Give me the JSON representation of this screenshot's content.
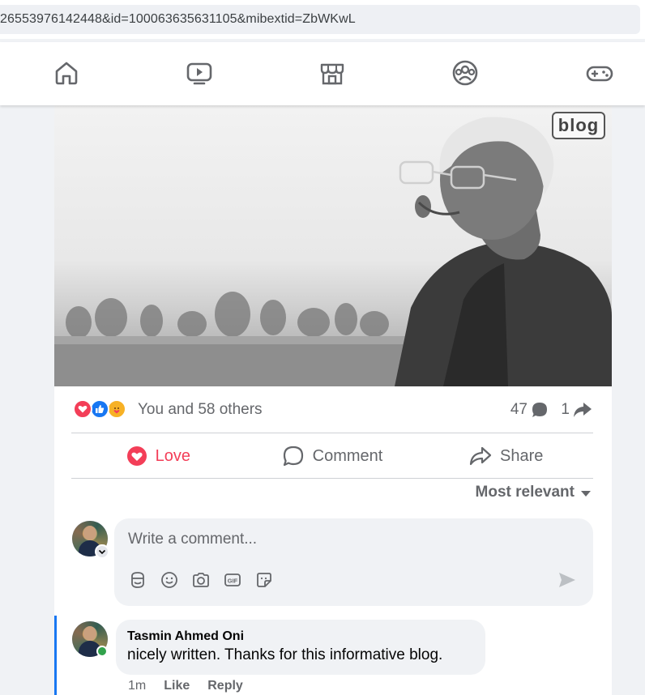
{
  "browser": {
    "url_visible": "26553976142448&id=100063635631105&mibextid=ZbWKwL"
  },
  "nav": {
    "tabs": [
      {
        "name": "home-tab",
        "icon": "home-icon"
      },
      {
        "name": "watch-tab",
        "icon": "video-icon"
      },
      {
        "name": "marketplace-tab",
        "icon": "store-icon"
      },
      {
        "name": "groups-tab",
        "icon": "groups-icon"
      },
      {
        "name": "gaming-tab",
        "icon": "gamepad-icon"
      }
    ]
  },
  "post": {
    "image_watermark": "blog",
    "reactions": {
      "icons": [
        "love-reaction-icon",
        "like-reaction-icon",
        "care-reaction-icon"
      ],
      "summary": "You and 58 others",
      "comments_count": "47",
      "shares_count": "1"
    },
    "actions": {
      "love_label": "Love",
      "comment_label": "Comment",
      "share_label": "Share"
    },
    "sort_label": "Most relevant",
    "composer": {
      "placeholder": "Write a comment..."
    },
    "comments": [
      {
        "author": "Tasmin Ahmed Oni",
        "text": "nicely written. Thanks for this informative blog.",
        "time": "1m",
        "like_label": "Like",
        "reply_label": "Reply"
      }
    ]
  },
  "colors": {
    "love": "#f33e58",
    "like": "#1877f2",
    "care": "#f7b125",
    "online": "#31a24c"
  }
}
